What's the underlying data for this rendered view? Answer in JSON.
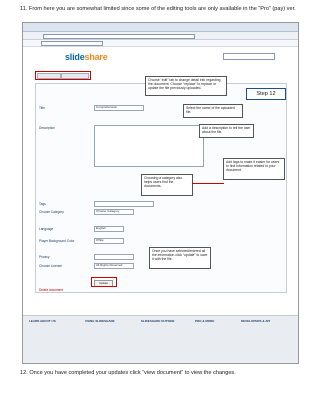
{
  "instructions": {
    "step11": "11.  From here you are somewhat limited since some of the editing tools are only available in the “Pro” (pay) ver.",
    "step12": "12.  Once you have completed your updates click “view document” to view the changes."
  },
  "screenshot": {
    "logo_part1": "slide",
    "logo_part2": "share",
    "callouts": {
      "upload": "Choose “edit” tab to change detail info regarding the document.  Choose “replace” to replace or update the file previously uploaded.",
      "step_label": "Step 12",
      "category_select": "Select the name of the uploaded file.",
      "description": "Add a description to tell the user about the file.",
      "tags": "Add tags to make it easier for users to find information related to your document.",
      "category": "Choosing a category also helps users find the documents.",
      "update": "Once you have selected/entered all the information click “update” to save it with the file."
    },
    "form": {
      "title_label": "Title",
      "title_value": "Comprehension",
      "description_label": "Description",
      "tags_label": "Tags",
      "category_label": "Choose Category",
      "category_value": "Choose Category",
      "language_label": "Language",
      "language_value": "English",
      "player_label": "Player Background Color",
      "player_value": "White",
      "privacy_label": "Privacy",
      "license_label": "Choose License",
      "license_value": "All Rights Reserved",
      "update_button": "Update",
      "delete_label": "Delete document"
    },
    "footer": {
      "col1": "LEARN ABOUT US",
      "col2": "USING SLIDESHARE",
      "col3": "SLIDESHARE OUTSIDE",
      "col4": "PRO & MORE",
      "col5": "DEVELOPERS & API"
    }
  },
  "colors": {
    "accent_red": "#d00000",
    "step_border": "#1f4f8a",
    "logo_blue": "#0b6aa5",
    "logo_orange": "#f08a1c"
  }
}
